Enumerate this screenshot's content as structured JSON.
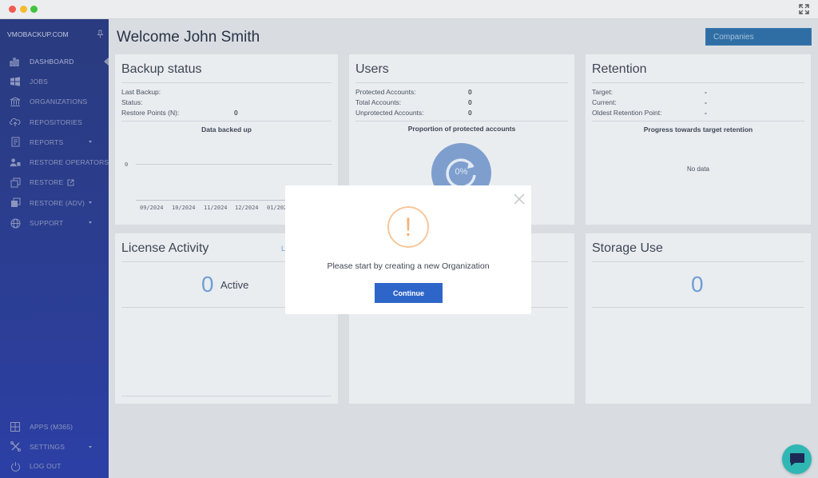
{
  "sidebar": {
    "brand": "VMOBACKUP.COM",
    "items": [
      {
        "label": "DASHBOARD",
        "icon": "bar-chart-icon",
        "active": true
      },
      {
        "label": "JOBS",
        "icon": "windows-icon"
      },
      {
        "label": "ORGANIZATIONS",
        "icon": "bank-icon"
      },
      {
        "label": "REPOSITORIES",
        "icon": "cloud-upload-icon"
      },
      {
        "label": "REPORTS",
        "icon": "report-icon",
        "caret": true
      },
      {
        "label": "RESTORE OPERATORS",
        "icon": "users-icon"
      },
      {
        "label": "RESTORE",
        "icon": "restore-icon",
        "external": true
      },
      {
        "label": "RESTORE (ADV)",
        "icon": "restore-adv-icon",
        "caret": true
      },
      {
        "label": "SUPPORT",
        "icon": "globe-icon",
        "caret": true
      }
    ],
    "bottom_items": [
      {
        "label": "APPS (M365)",
        "icon": "grid-icon"
      },
      {
        "label": "SETTINGS",
        "icon": "tools-icon",
        "caret": true
      },
      {
        "label": "LOG OUT",
        "icon": "power-icon"
      }
    ]
  },
  "header": {
    "welcome": "Welcome John Smith",
    "companies_button": "Companies"
  },
  "backup_status": {
    "title": "Backup status",
    "rows": [
      {
        "label": "Last Backup:",
        "value": ""
      },
      {
        "label": "Status:",
        "value": ""
      },
      {
        "label": "Restore Points (N):",
        "value": "0"
      }
    ],
    "chart_title": "Data backed up",
    "y_tick": "0",
    "x_ticks": [
      "09/2024",
      "10/2024",
      "11/2024",
      "12/2024",
      "01/202"
    ]
  },
  "users": {
    "title": "Users",
    "rows": [
      {
        "label": "Protected Accounts:",
        "value": "0"
      },
      {
        "label": "Total Accounts:",
        "value": "0"
      },
      {
        "label": "Unprotected Accounts:",
        "value": "0"
      }
    ],
    "chart_title": "Proportion of protected accounts",
    "percent": "0%"
  },
  "retention": {
    "title": "Retention",
    "rows": [
      {
        "label": "Target:",
        "value": "-"
      },
      {
        "label": "Current:",
        "value": "-"
      },
      {
        "label": "Oldest Retention Point:",
        "value": "-"
      }
    ],
    "chart_title": "Progress towards target retention",
    "no_data": "No data"
  },
  "license": {
    "title": "License Activity",
    "count": "0",
    "count_label": "Active",
    "link_partial": "L"
  },
  "storage": {
    "title": "Storage Use",
    "value": "0"
  },
  "modal": {
    "icon_glyph": "!",
    "message": "Please start by creating a new Organization",
    "button": "Continue"
  },
  "colors": {
    "sidebar": "#2b3d8e",
    "accent_button": "#2e65c9",
    "warning": "#f2b27a",
    "chat": "#2fb7b4"
  }
}
